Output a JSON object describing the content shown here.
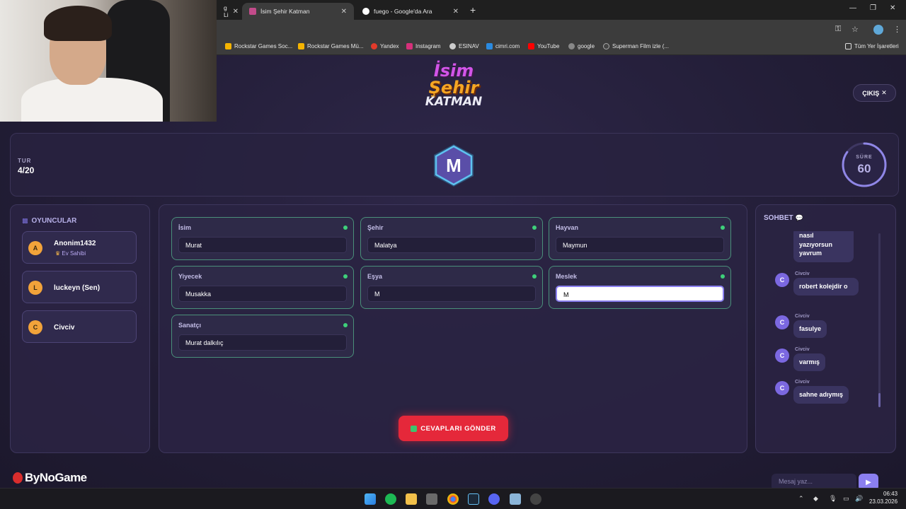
{
  "browser": {
    "tabs": [
      {
        "label": "g Li",
        "active": false
      },
      {
        "label": "İsim Şehir Katman",
        "active": true
      },
      {
        "label": "fuego - Google'da Ara",
        "active": false
      }
    ],
    "bookmarks": [
      "Rockstar Games Soc...",
      "Rockstar Games Mü...",
      "Yandex",
      "Instagram",
      "ESINAV",
      "cimri.com",
      "YouTube",
      "google",
      "Superman Film izle (...",
      "Tüm Yer İşaretleri"
    ]
  },
  "game": {
    "logo": {
      "line1": "İsim",
      "line2": "Şehir",
      "line3": "KATMAN"
    },
    "exit_label": "ÇIKIŞ",
    "round": {
      "label": "TUR",
      "value": "4/20"
    },
    "letter": "M",
    "timer": {
      "label": "SÜRE",
      "value": "60",
      "progress": 0.85
    },
    "players": {
      "title": "OYUNCULAR",
      "list": [
        {
          "initial": "A",
          "name": "Anonim1432",
          "role": "Ev Sahibi"
        },
        {
          "initial": "L",
          "name": "luckeyn (Sen)",
          "role": ""
        },
        {
          "initial": "C",
          "name": "Civciv",
          "role": ""
        }
      ]
    },
    "fields": [
      {
        "label": "İsim",
        "value": "Murat"
      },
      {
        "label": "Şehir",
        "value": "Malatya"
      },
      {
        "label": "Hayvan",
        "value": "Maymun"
      },
      {
        "label": "Yiyecek",
        "value": "Musakka"
      },
      {
        "label": "Eşya",
        "value": "M"
      },
      {
        "label": "Meslek",
        "value": "M"
      },
      {
        "label": "Sanatçı",
        "value": "Murat dalkılıç"
      }
    ],
    "submit_label": "CEVAPLARI GÖNDER",
    "chat": {
      "title": "SOHBET",
      "messages": [
        {
          "author": "",
          "text": "nasıl yazıyorsun yavrum"
        },
        {
          "author": "Civciv",
          "initial": "C",
          "text": "robert kolejdir o"
        },
        {
          "author": "Civciv",
          "initial": "C",
          "text": "fasulye"
        },
        {
          "author": "Civciv",
          "initial": "C",
          "text": "varmış"
        },
        {
          "author": "Civciv",
          "initial": "C",
          "text": "sahne adıymış"
        }
      ],
      "input_placeholder": "Mesaj yaz..."
    }
  },
  "watermark": "ByNoGame",
  "taskbar": {
    "time": "06:43",
    "date": "23.03.2026"
  }
}
